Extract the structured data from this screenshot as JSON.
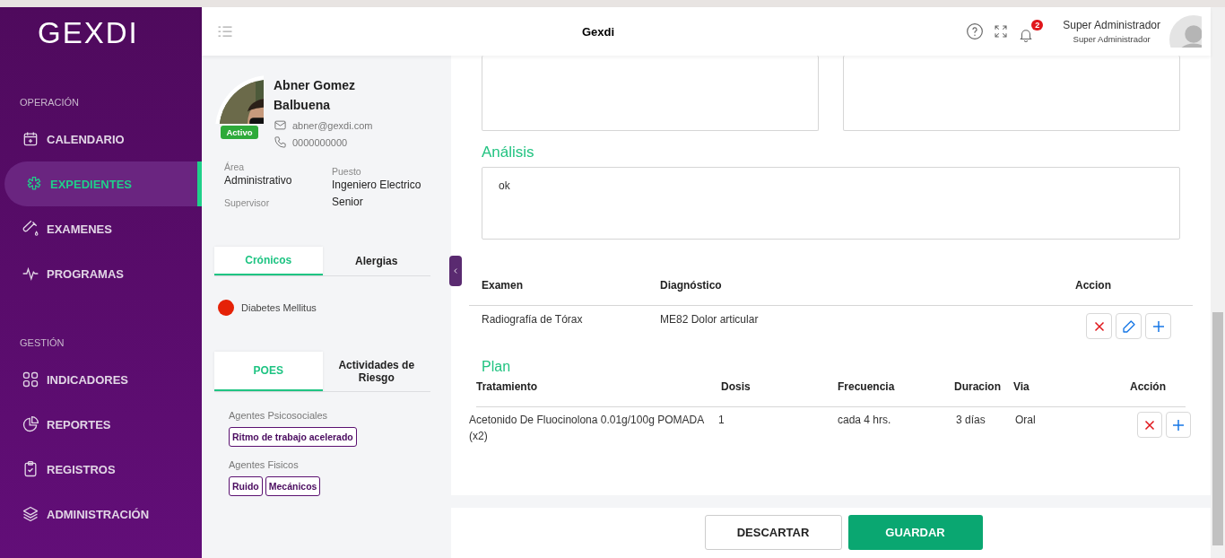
{
  "sidebar": {
    "logo": "GEXDI",
    "sections": [
      {
        "title": "OPERACIÓN",
        "items": [
          {
            "label": "CALENDARIO",
            "selected": false
          },
          {
            "label": "EXPEDIENTES",
            "selected": true
          },
          {
            "label": "EXAMENES",
            "selected": false
          },
          {
            "label": "PROGRAMAS",
            "selected": false
          }
        ]
      },
      {
        "title": "GESTIÓN",
        "items": [
          {
            "label": "INDICADORES",
            "selected": false
          },
          {
            "label": "REPORTES",
            "selected": false
          },
          {
            "label": "REGISTROS",
            "selected": false
          },
          {
            "label": "ADMINISTRACIÓN",
            "selected": false
          }
        ]
      }
    ]
  },
  "header": {
    "title": "Gexdi",
    "notifications": "2",
    "user_name": "Super Administrador",
    "user_role": "Super Administrador"
  },
  "patient": {
    "name": "Abner Gomez Balbuena",
    "status": "Activo",
    "email": "abner@gexdi.com",
    "phone": "0000000000",
    "fields": [
      {
        "label": "Área",
        "value": "Administrativo"
      },
      {
        "label": "Supervisor"
      },
      {
        "label": "Puesto",
        "value": "Ingeniero Electrico Senior"
      }
    ],
    "tabs1": [
      {
        "label": "Crónicos",
        "selected": true
      },
      {
        "label": "Alergias",
        "selected": false
      }
    ],
    "conditions": [
      {
        "name": "Diabetes Mellitus",
        "color": "#e52207"
      }
    ],
    "tabs2": [
      {
        "label": "POES",
        "selected": true
      },
      {
        "label": "Actividades de Riesgo",
        "selected": false
      }
    ],
    "agent_groups": [
      {
        "title": "Agentes Psicosociales",
        "tags": [
          "Ritmo de trabajo acelerado"
        ]
      },
      {
        "title": "Agentes Fisicos",
        "tags": [
          "Ruido",
          "Mecánicos"
        ]
      }
    ]
  },
  "analysis": {
    "title": "Análisis",
    "value": "ok"
  },
  "exams": {
    "columns": [
      "Examen",
      "Diagnóstico",
      "Accion"
    ],
    "rows": [
      {
        "cells": [
          "Radiografía de Tórax",
          "ME82 Dolor articular"
        ]
      }
    ]
  },
  "plan": {
    "title": "Plan",
    "columns": [
      "Tratamiento",
      "Dosis",
      "Frecuencia",
      "Duracion",
      "Via",
      "Acción"
    ],
    "rows": [
      {
        "cells": [
          "Acetonido De Fluocinolona 0.01g/100g POMADA (x2)",
          "1",
          "cada 4 hrs.",
          "3 días",
          "Oral"
        ]
      }
    ]
  },
  "buttons": [
    {
      "label": "DESCARTAR",
      "kind": "secondary"
    },
    {
      "label": "GUARDAR",
      "kind": "primary"
    }
  ]
}
